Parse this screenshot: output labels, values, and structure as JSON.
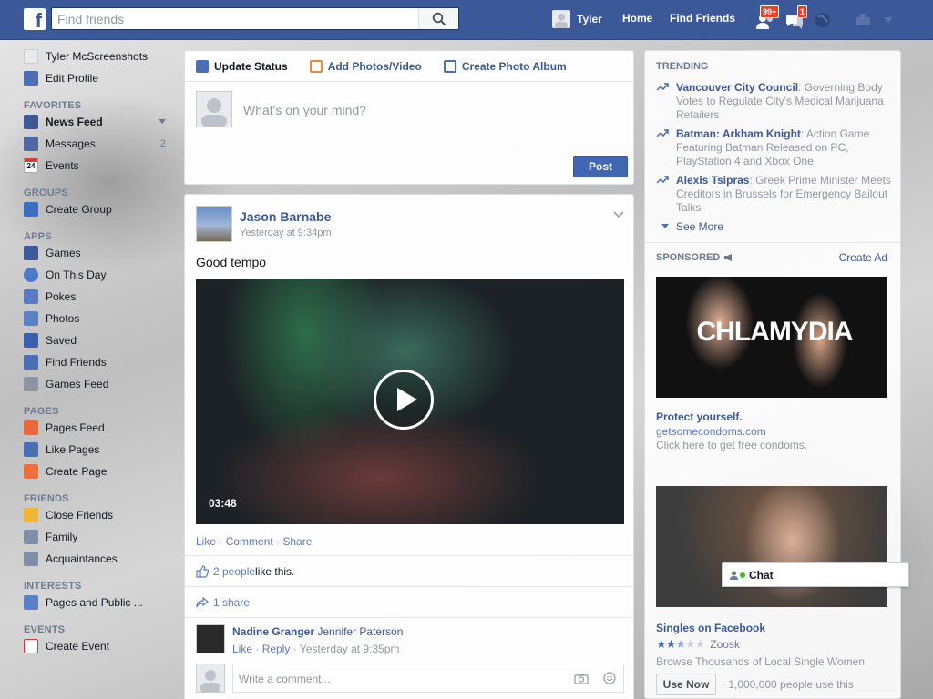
{
  "topbar": {
    "logo_letter": "f",
    "search_placeholder": "Find friends",
    "user_name": "Tyler",
    "home_label": "Home",
    "find_friends_label": "Find Friends",
    "friend_requests_badge": "99+",
    "messages_badge": "1"
  },
  "sidebar": {
    "profile_name": "Tyler McScreenshots",
    "edit_profile": "Edit Profile",
    "sections": {
      "favorites": "FAVORITES",
      "groups": "GROUPS",
      "apps": "APPS",
      "pages": "PAGES",
      "friends": "FRIENDS",
      "interests": "INTERESTS",
      "events": "EVENTS"
    },
    "favorites": [
      {
        "label": "News Feed"
      },
      {
        "label": "Messages",
        "count": "2"
      },
      {
        "label": "Events",
        "icon_text": "24"
      }
    ],
    "groups": [
      {
        "label": "Create Group"
      }
    ],
    "apps": [
      {
        "label": "Games"
      },
      {
        "label": "On This Day"
      },
      {
        "label": "Pokes"
      },
      {
        "label": "Photos"
      },
      {
        "label": "Saved"
      },
      {
        "label": "Find Friends"
      },
      {
        "label": "Games Feed"
      }
    ],
    "pages": [
      {
        "label": "Pages Feed"
      },
      {
        "label": "Like Pages"
      },
      {
        "label": "Create Page"
      }
    ],
    "friends": [
      {
        "label": "Close Friends"
      },
      {
        "label": "Family"
      },
      {
        "label": "Acquaintances"
      }
    ],
    "interests": [
      {
        "label": "Pages and Public ..."
      }
    ],
    "events": [
      {
        "label": "Create Event"
      }
    ]
  },
  "composer": {
    "tabs": [
      "Update Status",
      "Add Photos/Video",
      "Create Photo Album"
    ],
    "placeholder": "What's on your mind?",
    "post_button": "Post"
  },
  "post": {
    "author": "Jason Barnabe",
    "timestamp": "Yesterday at 9:34pm",
    "text": "Good tempo",
    "video_duration": "03:48",
    "actions": [
      "Like",
      "Comment",
      "Share"
    ],
    "likes_link": "2 people",
    "likes_suffix": " like this.",
    "shares": "1 share",
    "comment": {
      "author": "Nadine Granger",
      "text": "Jennifer Paterson",
      "like": "Like",
      "reply": "Reply",
      "time": "Yesterday at 9:35pm"
    },
    "comment_placeholder": "Write a comment..."
  },
  "trending": {
    "header": "TRENDING",
    "items": [
      {
        "topic": "Vancouver City Council",
        "desc": ": Governing Body Votes to Regulate City's Medical Marijuana Retailers"
      },
      {
        "topic": "Batman: Arkham Knight",
        "desc": ": Action Game Featuring Batman Released on PC, PlayStation 4 and Xbox One"
      },
      {
        "topic": "Alexis Tsipras",
        "desc": ": Greek Prime Minister Meets Creditors in Brussels for Emergency Bailout Talks"
      }
    ],
    "see_more": "See More"
  },
  "sponsored": {
    "header": "SPONSORED",
    "create_ad": "Create Ad",
    "ad1": {
      "image_text": "CHLAMYDIA",
      "title": "Protect yourself.",
      "url": "getsomecondoms.com",
      "desc": "Click here to get free condoms."
    },
    "ad2": {
      "title": "Singles on Facebook",
      "rater": "Zoosk",
      "rating": 2.5,
      "desc": "Browse Thousands of Local Single Women",
      "button": "Use Now",
      "social": "· 1,000,000 people use this"
    }
  },
  "chat": {
    "label": "Chat"
  }
}
